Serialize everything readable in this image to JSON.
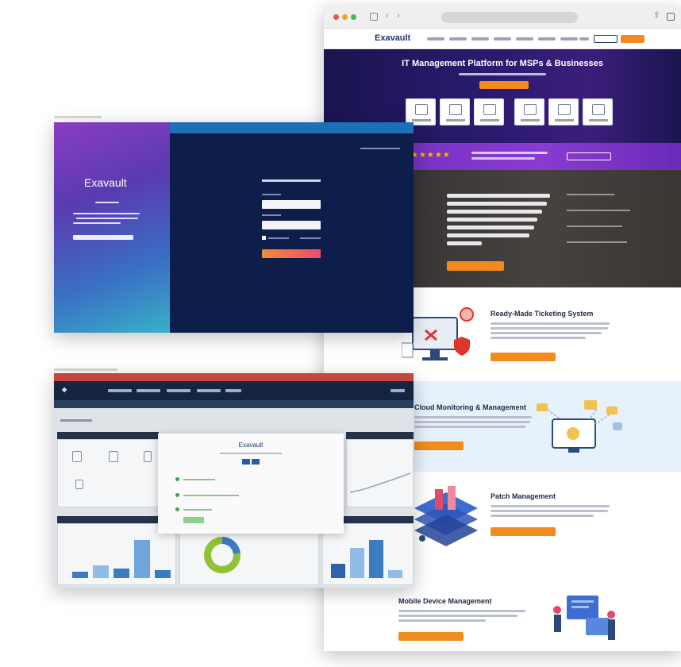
{
  "site": {
    "logo": "Exavault",
    "hero_title": "IT Management Platform for MSPs & Businesses",
    "rating_stars": "★★★★★",
    "features": [
      {
        "title": "Ready-Made Ticketing System"
      },
      {
        "title": "Cloud Monitoring & Management"
      },
      {
        "title": "Patch Management"
      },
      {
        "title": "Mobile Device Management"
      }
    ]
  },
  "login": {
    "logo": "Exavault"
  },
  "dashboard": {
    "modal_logo": "Exavault"
  },
  "colors": {
    "accent_orange": "#f28b1d",
    "hero_navy": "#1a1550",
    "purple_band": "#8a3bd1",
    "login_navy": "#0e1e4a",
    "dash_navy": "#15253f",
    "chart_blue": "#3a7cc0",
    "donut_green": "#8fc234"
  },
  "icons": {
    "ticket_illustration": "monitor-shield-icon",
    "cloud_illustration": "monitor-cloud-icon",
    "patch_illustration": "server-stack-icon",
    "mobile_illustration": "people-devices-icon"
  }
}
